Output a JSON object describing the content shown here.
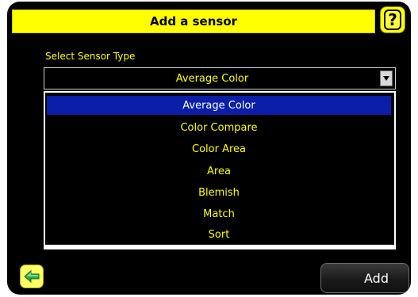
{
  "header": {
    "title": "Add a sensor",
    "help_label": "?"
  },
  "sensor_type": {
    "label": "Select Sensor Type",
    "selected_value": "Average Color"
  },
  "options": [
    {
      "label": "Average Color",
      "selected": true
    },
    {
      "label": "Color Compare",
      "selected": false
    },
    {
      "label": "Color Area",
      "selected": false
    },
    {
      "label": "Area",
      "selected": false
    },
    {
      "label": "Blemish",
      "selected": false
    },
    {
      "label": "Match",
      "selected": false
    },
    {
      "label": "Sort",
      "selected": false
    }
  ],
  "footer": {
    "back_icon": "back-arrow-icon",
    "add_label": "Add"
  },
  "colors": {
    "accent_yellow": "#ffff00",
    "selection_blue": "#0a1ea8",
    "background": "#000000"
  }
}
